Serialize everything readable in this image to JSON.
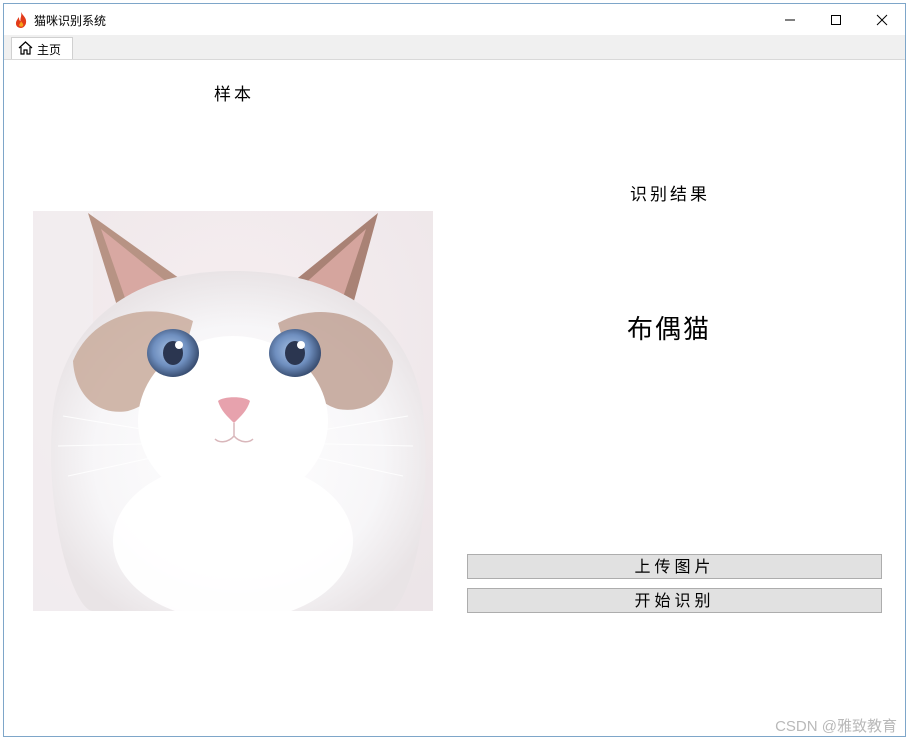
{
  "window": {
    "title": "猫咪识别系统",
    "app_icon": "flame-icon",
    "controls": [
      "minimize-icon",
      "maximize-icon",
      "close-icon"
    ]
  },
  "tabs": [
    {
      "icon": "home-icon",
      "label": "主页"
    }
  ],
  "main": {
    "sample_label": "样本",
    "sample_image": "cat-photo",
    "result_title": "识别结果",
    "result_value": "布偶猫",
    "upload_button": "上传图片",
    "recognize_button": "开始识别"
  },
  "watermark": "CSDN @雅致教育"
}
